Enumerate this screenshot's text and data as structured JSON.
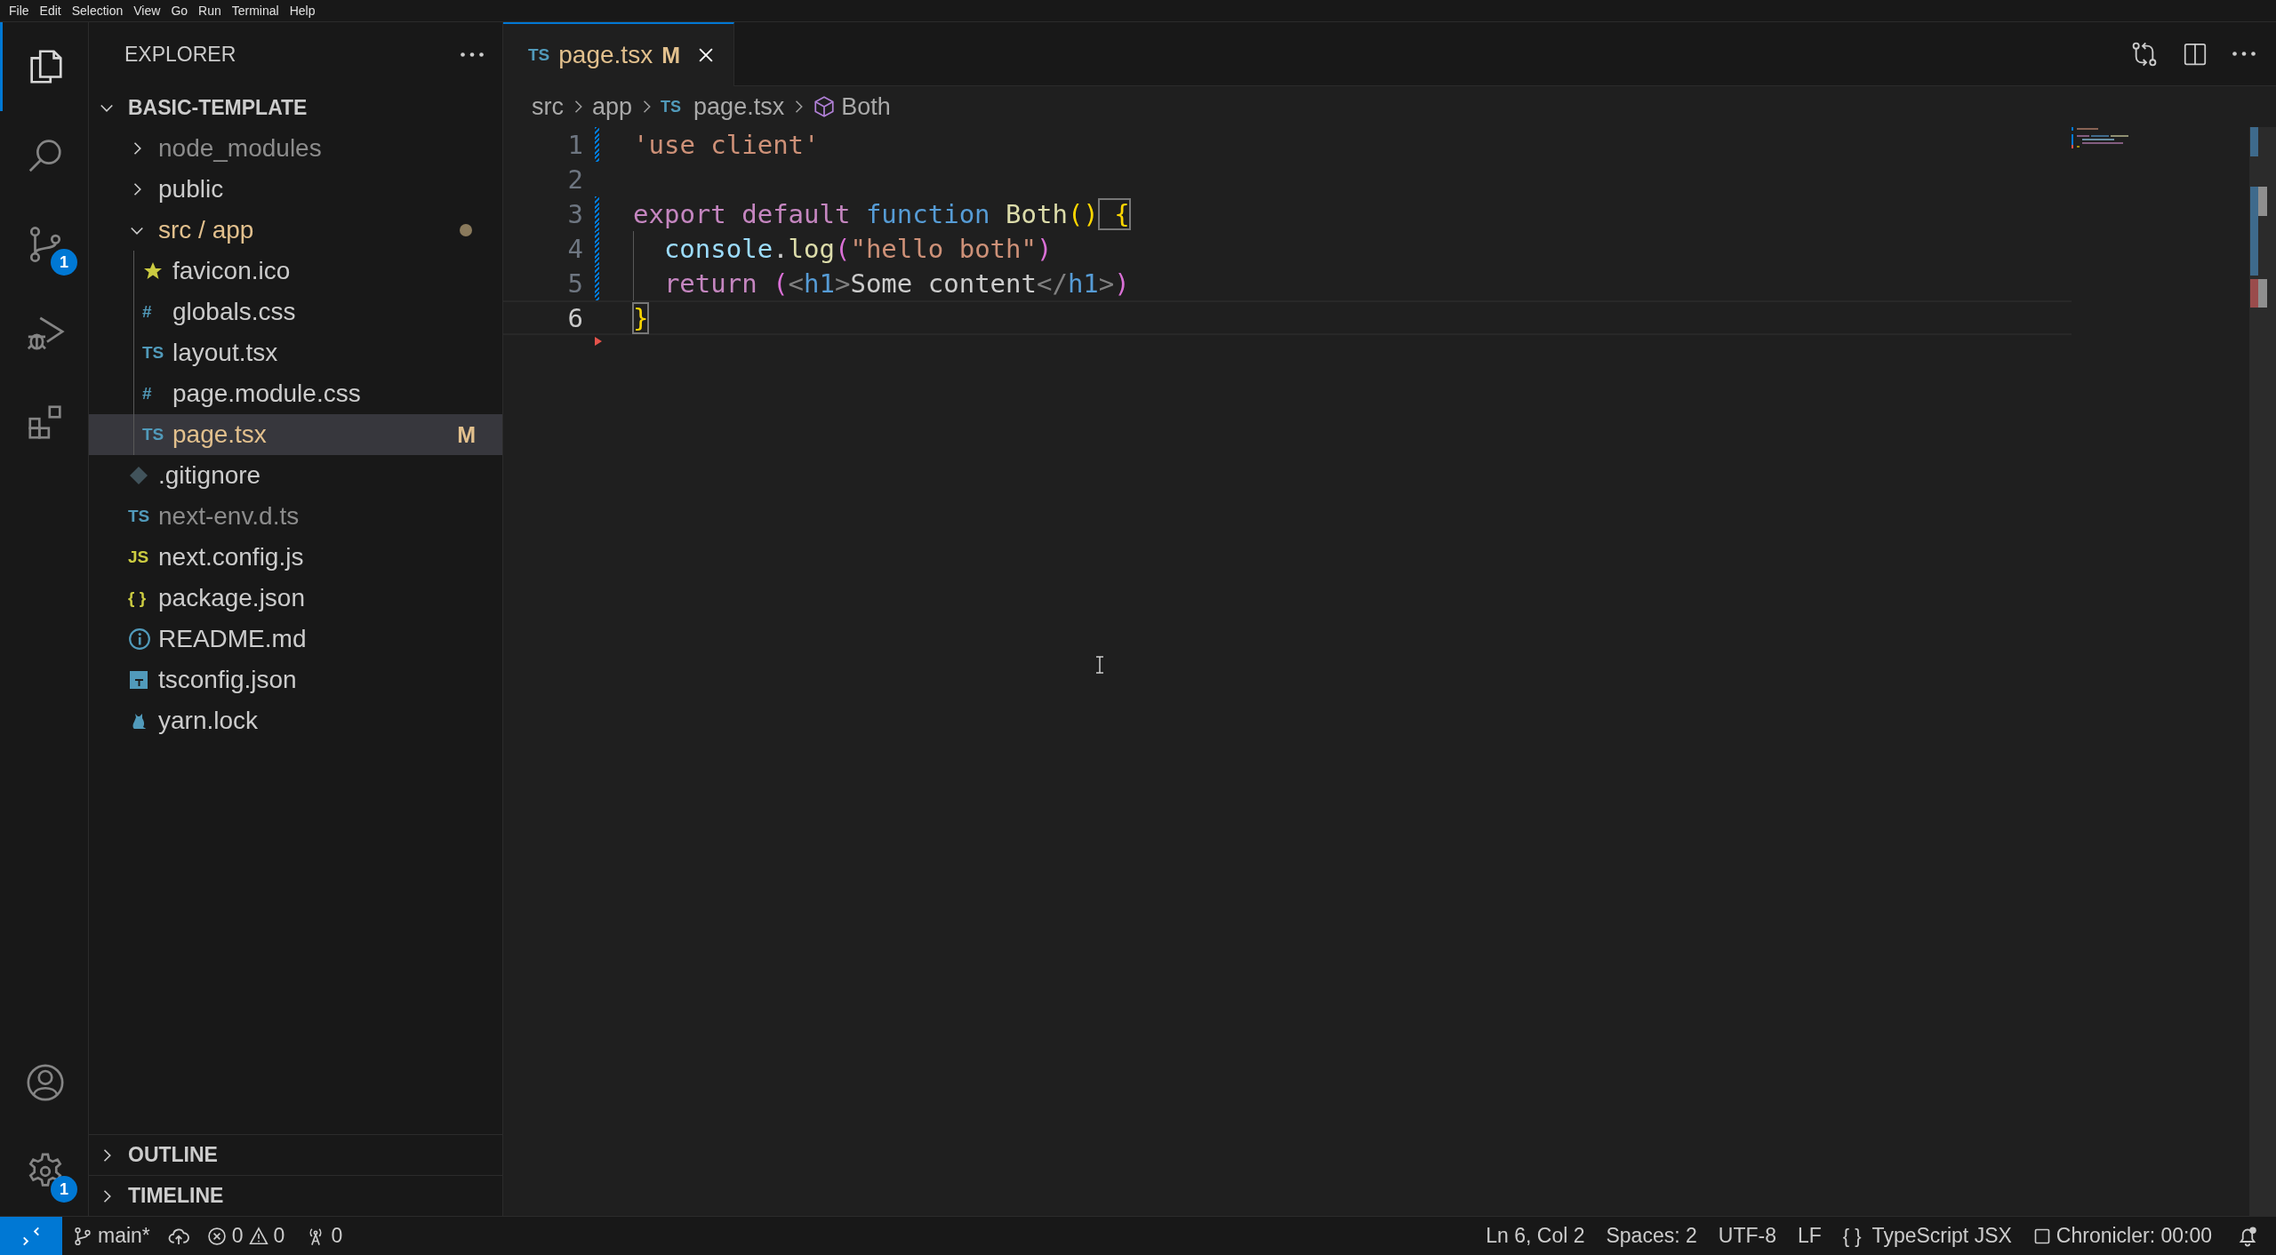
{
  "menu_bar": [
    "File",
    "Edit",
    "Selection",
    "View",
    "Go",
    "Run",
    "Terminal",
    "Help"
  ],
  "activity_bar": {
    "top": [
      {
        "kind": "explorer",
        "selected": true
      },
      {
        "kind": "search",
        "selected": false
      },
      {
        "kind": "source-control",
        "selected": false,
        "badge": "1"
      },
      {
        "kind": "run-debug",
        "selected": false
      },
      {
        "kind": "extensions",
        "selected": false
      }
    ],
    "bottom": [
      {
        "kind": "accounts"
      },
      {
        "kind": "manage",
        "badge": "1"
      }
    ]
  },
  "explorer": {
    "title": "EXPLORER",
    "root": {
      "label": "BASIC-TEMPLATE",
      "expanded": true,
      "children": [
        {
          "label": "node_modules",
          "kind": "folder",
          "expanded": false,
          "ignored": true,
          "modified": false,
          "selected": false
        },
        {
          "label": "public",
          "kind": "folder",
          "expanded": false,
          "ignored": false,
          "modified": false,
          "selected": false
        },
        {
          "label": "src / app",
          "kind": "folder",
          "expanded": true,
          "ignored": false,
          "modified": true,
          "selected": false,
          "children": [
            {
              "label": "favicon.ico",
              "kind": "image",
              "ignored": false,
              "modified": false,
              "selected": false
            },
            {
              "label": "globals.css",
              "kind": "stylesheet",
              "glyph": "#",
              "ignored": false,
              "modified": false,
              "selected": false
            },
            {
              "label": "layout.tsx",
              "kind": "typescript",
              "glyph": "TS",
              "ignored": false,
              "modified": false,
              "selected": false
            },
            {
              "label": "page.module.css",
              "kind": "stylesheet",
              "glyph": "#",
              "ignored": false,
              "modified": false,
              "selected": false
            },
            {
              "label": "page.tsx",
              "kind": "typescript",
              "glyph": "TS",
              "ignored": false,
              "modified": true,
              "decoration": "M",
              "selected": true
            }
          ]
        },
        {
          "label": ".gitignore",
          "kind": "gitignore",
          "ignored": false,
          "modified": false,
          "selected": false
        },
        {
          "label": "next-env.d.ts",
          "kind": "typescript",
          "glyph": "TS",
          "ignored": true,
          "modified": false,
          "selected": false
        },
        {
          "label": "next.config.js",
          "kind": "javascript",
          "glyph": "JS",
          "ignored": false,
          "modified": false,
          "selected": false
        },
        {
          "label": "package.json",
          "kind": "json",
          "glyph": "{ }",
          "ignored": false,
          "modified": false,
          "selected": false
        },
        {
          "label": "README.md",
          "kind": "readme",
          "ignored": false,
          "modified": false,
          "selected": false
        },
        {
          "label": "tsconfig.json",
          "kind": "tsconfig",
          "ignored": false,
          "modified": false,
          "selected": false
        },
        {
          "label": "yarn.lock",
          "kind": "lockfile",
          "ignored": false,
          "modified": false,
          "selected": false
        }
      ]
    },
    "sections": [
      {
        "label": "OUTLINE",
        "expanded": false
      },
      {
        "label": "TIMELINE",
        "expanded": false
      }
    ]
  },
  "editor": {
    "tabs": [
      {
        "label": "page.tsx",
        "glyph": "TS",
        "decoration": "M",
        "modified": true,
        "selected": true
      }
    ],
    "breadcrumbs": [
      {
        "kind": "folder",
        "label": "src"
      },
      {
        "kind": "folder",
        "label": "app"
      },
      {
        "kind": "file",
        "glyph": "TS",
        "label": "page.tsx"
      },
      {
        "kind": "symbol",
        "label": "Both"
      }
    ],
    "lines": [
      {
        "number": "1",
        "modified": true,
        "deleted_below": false,
        "current": false,
        "indented": false,
        "tokens": [
          {
            "t": "'use client'",
            "kind": "string"
          }
        ]
      },
      {
        "number": "2",
        "modified": false,
        "deleted_below": false,
        "current": false,
        "indented": false
      },
      {
        "number": "3",
        "modified": true,
        "deleted_below": false,
        "current": false,
        "indented": false,
        "tokens": [
          {
            "t": "export default",
            "kind": "keyword"
          },
          {
            "t": " function",
            "kind": "storage"
          },
          {
            "t": " Both",
            "kind": "function"
          },
          {
            "t": "()",
            "kind": "bracket1"
          },
          {
            "t": " {",
            "kind": "bracket1",
            "matched": true
          }
        ]
      },
      {
        "number": "4",
        "modified": true,
        "deleted_below": false,
        "current": false,
        "indented": true,
        "tokens": [
          {
            "t": "console",
            "kind": "variable"
          },
          {
            "t": ".",
            "kind": "plain"
          },
          {
            "t": "log",
            "kind": "function"
          },
          {
            "t": "(",
            "kind": "bracket2"
          },
          {
            "t": "\"hello both\"",
            "kind": "string"
          },
          {
            "t": ")",
            "kind": "bracket2"
          }
        ]
      },
      {
        "number": "5",
        "modified": true,
        "deleted_below": false,
        "current": false,
        "indented": true,
        "tokens": [
          {
            "t": "return",
            "kind": "keyword"
          },
          {
            "t": " (",
            "kind": "bracket2"
          },
          {
            "t": "<",
            "kind": "punct"
          },
          {
            "t": "h1",
            "kind": "tag"
          },
          {
            "t": ">",
            "kind": "punct"
          },
          {
            "t": "Some content",
            "kind": "plain"
          },
          {
            "t": "</",
            "kind": "punct"
          },
          {
            "t": "h1",
            "kind": "tag"
          },
          {
            "t": ">",
            "kind": "punct"
          },
          {
            "t": ")",
            "kind": "bracket2"
          }
        ]
      },
      {
        "number": "6",
        "modified": false,
        "deleted_below": true,
        "current": true,
        "indented": false,
        "tokens": [
          {
            "t": "}",
            "kind": "bracket1",
            "matched": true
          }
        ]
      }
    ]
  },
  "status_bar": {
    "branch": "main*",
    "errors": "0",
    "warnings": "0",
    "ports": "0",
    "position": "Ln 6, Col 2",
    "indentation": "Spaces: 2",
    "encoding": "UTF-8",
    "eol": "LF",
    "language_glyph": "{ }",
    "language": "TypeScript JSX",
    "chronicler": "Chronicler: 00:00",
    "notifications_unread": true
  }
}
